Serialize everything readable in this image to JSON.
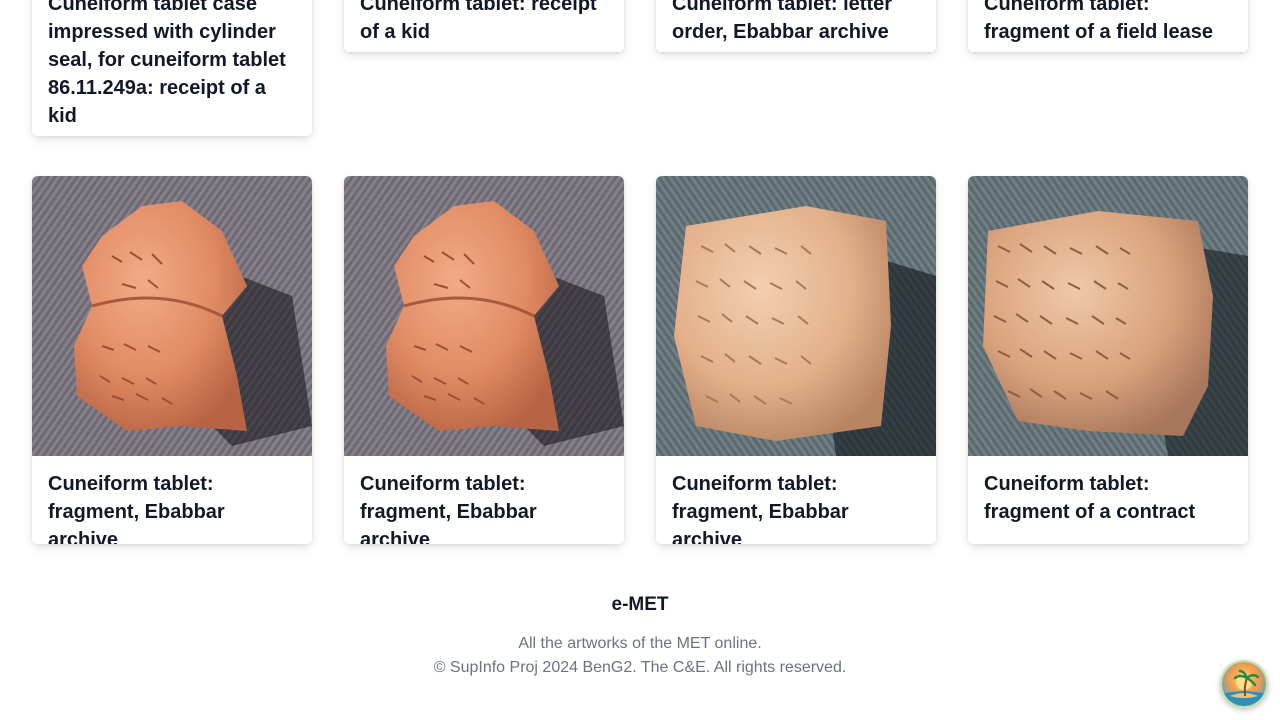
{
  "top_cards": [
    {
      "title": "Cuneiform tablet case impressed with cylinder seal, for cuneiform tablet 86.11.249a: receipt of a kid"
    },
    {
      "title": "Cuneiform tablet: receipt of a kid"
    },
    {
      "title": "Cuneiform tablet: letter order, Ebabbar archive"
    },
    {
      "title": "Cuneiform tablet: fragment of a field lease"
    }
  ],
  "bottom_cards": [
    {
      "title": "Cuneiform tablet: fragment, Ebabbar archive"
    },
    {
      "title": "Cuneiform tablet: fragment, Ebabbar archive"
    },
    {
      "title": "Cuneiform tablet: fragment, Ebabbar archive"
    },
    {
      "title": "Cuneiform tablet: fragment of a contract"
    }
  ],
  "footer": {
    "brand": "e-MET",
    "tagline": "All the artworks of the MET online.",
    "copyright": "© SupInfo Proj 2024 BenG2. The C&E. All rights reserved."
  },
  "fab": {
    "icon": "palm-island-icon"
  },
  "colors": {
    "text": "#111827",
    "muted": "#6b7280",
    "background": "#ffffff"
  }
}
